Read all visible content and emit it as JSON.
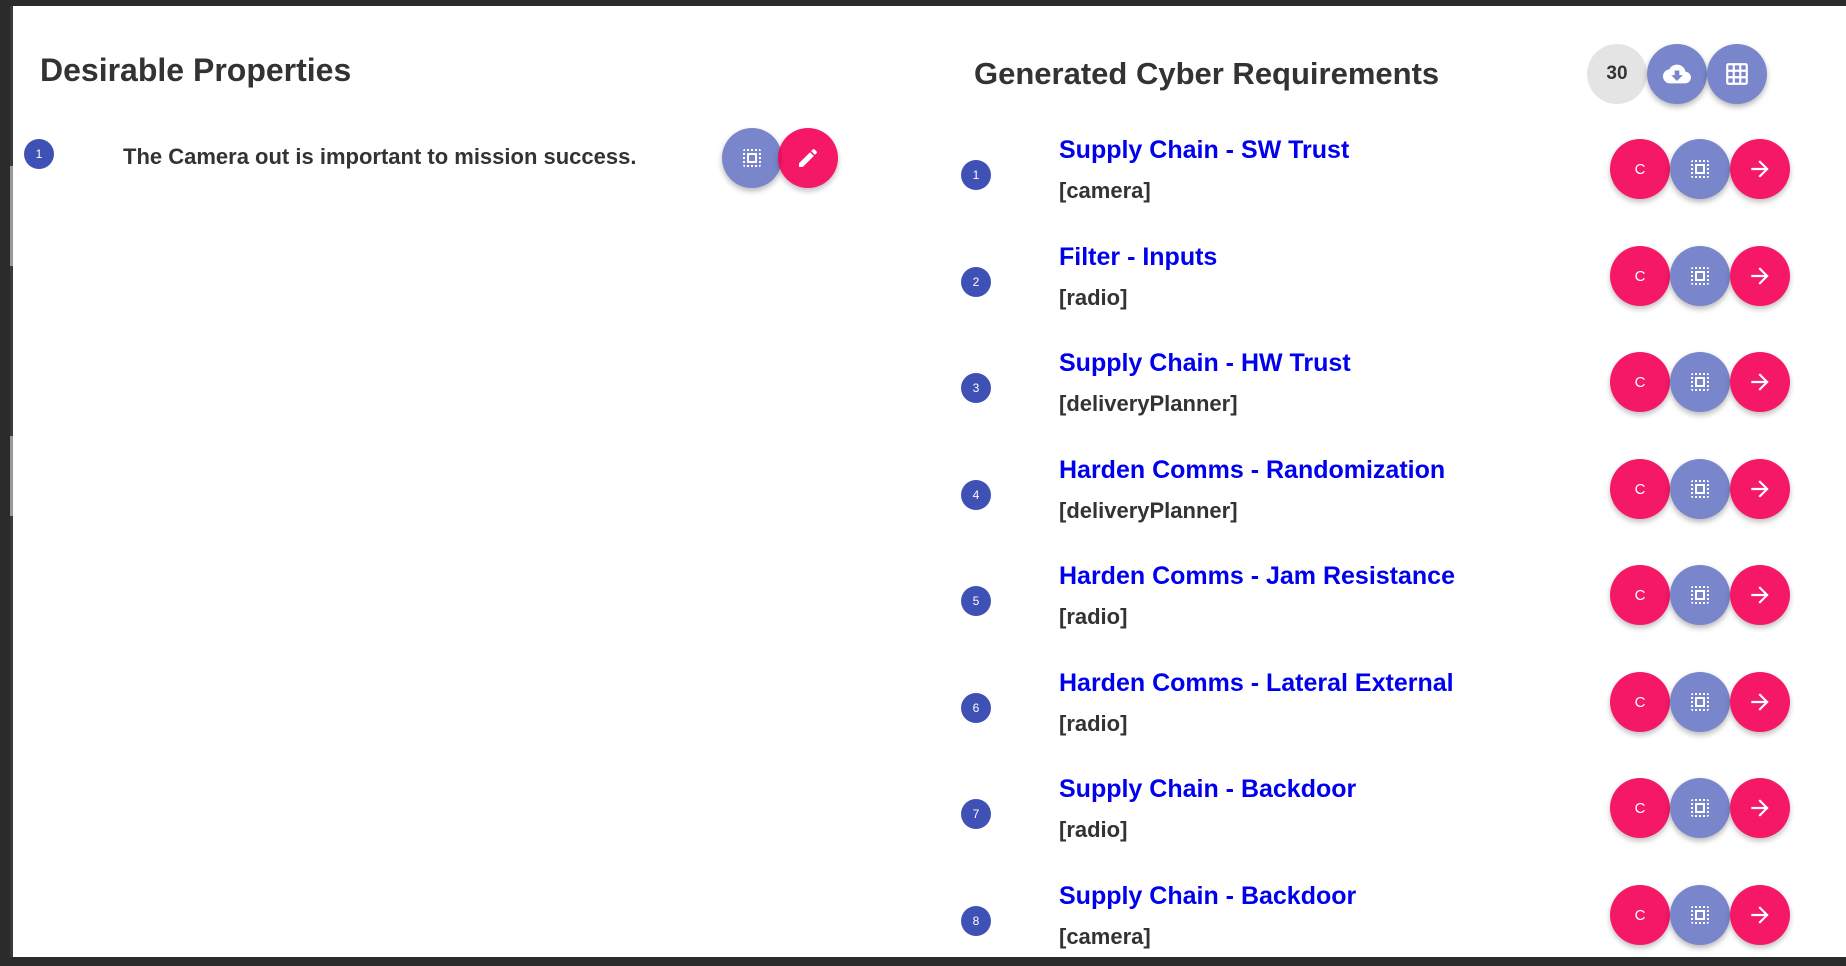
{
  "colors": {
    "badge": "#3f51b5",
    "indigo_button": "#7986cb",
    "pink_button": "#f50057",
    "link": "#0000ee"
  },
  "left_panel": {
    "title": "Desirable Properties",
    "properties": [
      {
        "number": "1",
        "text": "The Camera out is important to mission success."
      }
    ]
  },
  "right_panel": {
    "title": "Generated Cyber Requirements",
    "count": "30",
    "header_icons": [
      "cloud-download-icon",
      "grid-table-icon"
    ],
    "row_buttons": {
      "c_label": "C",
      "select_icon": "select-all-icon",
      "go_icon": "arrow-forward-icon"
    },
    "requirements": [
      {
        "number": "1",
        "title": "Supply Chain - SW Trust",
        "component": "[camera]"
      },
      {
        "number": "2",
        "title": "Filter - Inputs",
        "component": "[radio]"
      },
      {
        "number": "3",
        "title": "Supply Chain - HW Trust",
        "component": "[deliveryPlanner]"
      },
      {
        "number": "4",
        "title": "Harden Comms - Randomization",
        "component": "[deliveryPlanner]"
      },
      {
        "number": "5",
        "title": "Harden Comms - Jam Resistance",
        "component": "[radio]"
      },
      {
        "number": "6",
        "title": "Harden Comms - Lateral External",
        "component": "[radio]"
      },
      {
        "number": "7",
        "title": "Supply Chain - Backdoor",
        "component": "[radio]"
      },
      {
        "number": "8",
        "title": "Supply Chain - Backdoor",
        "component": "[camera]"
      }
    ]
  }
}
